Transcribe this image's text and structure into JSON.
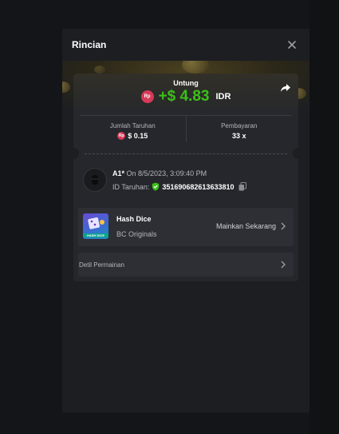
{
  "modal": {
    "title": "Rincian"
  },
  "profit": {
    "label": "Untung",
    "currency_badge": "Rp",
    "value": "+$ 4.83",
    "currency": "IDR"
  },
  "stats": {
    "bet_amount": {
      "label": "Jumlah Taruhan",
      "currency_badge": "Rp",
      "value": "$ 0.15"
    },
    "payout": {
      "label": "Pembayaran",
      "value": "33 x"
    }
  },
  "bet": {
    "user": "A1*",
    "timestamp": "On 8/5/2023, 3:09:40 PM",
    "id_label": "ID Taruhan:",
    "id_value": "351690682613633810"
  },
  "game": {
    "name": "Hash Dice",
    "provider": "BC Originals",
    "thumb_text": "HASH DICE",
    "play_label": "Mainkan Sekarang"
  },
  "details": {
    "label": "Detil Permainan"
  },
  "colors": {
    "profit_green": "#3bc117",
    "rp_red": "#d63a58",
    "verified_green": "#3bc117"
  }
}
